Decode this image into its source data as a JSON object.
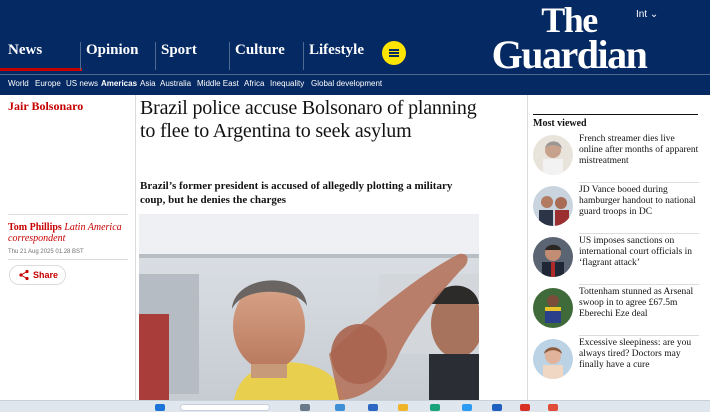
{
  "header": {
    "edition": "Int",
    "logo_line1": "The",
    "logo_line2": "Guardian",
    "pillars": [
      "News",
      "Opinion",
      "Sport",
      "Culture",
      "Lifestyle"
    ],
    "active_pillar": "News",
    "menu_icon": "hamburger-icon"
  },
  "subnav": [
    "World",
    "Europe",
    "US news",
    "Americas",
    "Asia",
    "Australia",
    "Middle East",
    "Africa",
    "Inequality",
    "Global development"
  ],
  "subnav_current": "Americas",
  "article": {
    "tag": "Jair Bolsonaro",
    "headline": "Brazil police accuse Bolsonaro of planning to flee to Argentina to seek asylum",
    "standfirst": "Brazil’s former president is accused of allegedly plotting a military coup, but he denies the charges",
    "author": "Tom Phillips",
    "author_role": "Latin America correspondent",
    "date": "Thu 21 Aug 2025 01.28 BST",
    "share_label": "Share"
  },
  "most_viewed": {
    "title": "Most viewed",
    "items": [
      "French streamer dies live online after months of apparent mistreatment",
      "JD Vance booed during hamburger handout to national guard troops in DC",
      "US imposes sanctions on international court officials in ‘flagrant attack’",
      "Tottenham stunned as Arsenal swoop in to agree £67.5m Eberechi Eze deal",
      "Excessive sleepiness: are you always tired? Doctors may finally have a cure"
    ]
  },
  "colors": {
    "brand_blue": "#052962",
    "accent_red": "#c70000",
    "menu_yellow": "#ffe500"
  }
}
